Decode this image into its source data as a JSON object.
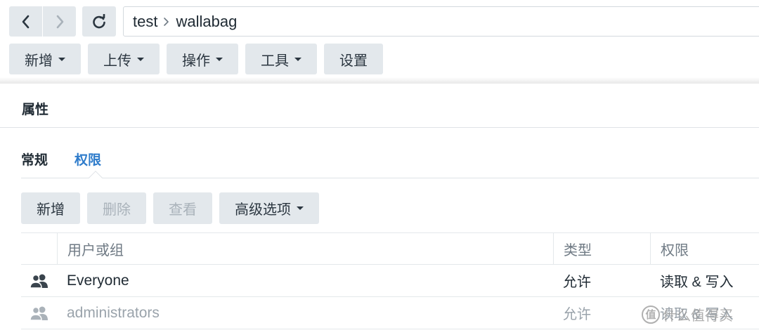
{
  "toolbar": {
    "path": {
      "root": "test",
      "current": "wallabag"
    },
    "actions": [
      {
        "label": "新增",
        "has_caret": true
      },
      {
        "label": "上传",
        "has_caret": true
      },
      {
        "label": "操作",
        "has_caret": true
      },
      {
        "label": "工具",
        "has_caret": true
      },
      {
        "label": "设置",
        "has_caret": false
      }
    ],
    "icons": {
      "back": "chevron-left-icon",
      "forward": "chevron-right-icon",
      "refresh": "refresh-icon",
      "path_separator": "chevron-right-icon"
    }
  },
  "panel": {
    "title": "属性",
    "tabs": [
      {
        "label": "常规",
        "active": false
      },
      {
        "label": "权限",
        "active": true
      }
    ],
    "perm_actions": [
      {
        "label": "新增",
        "enabled": true,
        "has_caret": false
      },
      {
        "label": "删除",
        "enabled": false,
        "has_caret": false
      },
      {
        "label": "查看",
        "enabled": false,
        "has_caret": false
      },
      {
        "label": "高级选项",
        "enabled": true,
        "has_caret": true
      }
    ],
    "table": {
      "headers": {
        "name": "用户或组",
        "type": "类型",
        "permission": "权限"
      },
      "rows": [
        {
          "icon": "group-icon",
          "name": "Everyone",
          "type": "允许",
          "permission": "读取 & 写入",
          "dimmed": false
        },
        {
          "icon": "group-icon",
          "name": "administrators",
          "type": "允许",
          "permission": "读取 & 写入",
          "dimmed": true
        }
      ]
    }
  },
  "watermark": {
    "badge": "值",
    "text": "什么值得买"
  },
  "colors": {
    "accent": "#2f7ccb",
    "button_bg": "#e3e8ec",
    "text": "#1f2a33",
    "muted": "#9aa3ab"
  }
}
